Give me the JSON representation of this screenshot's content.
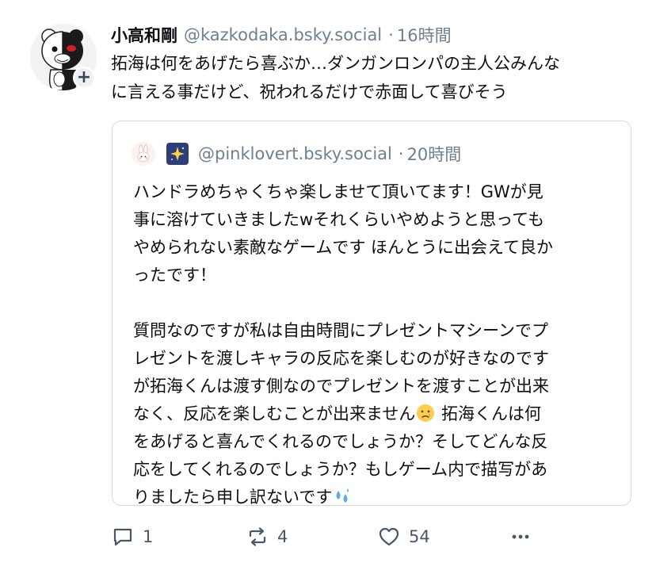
{
  "post": {
    "author": {
      "display_name": "小高和剛",
      "handle": "@kazkodaka.bsky.social",
      "separator": "·",
      "time": "16時間",
      "avatar_icon": "monokuma-avatar",
      "follow_badge": "+"
    },
    "text_lines": [
      "拓海は何をあげたら喜ぶか…ダンガンロンパの主人公みんな",
      "に言える事だけど、祝われるだけで赤面して喜びそう"
    ],
    "quote": {
      "avatar_icon": "bunny-avatar",
      "name_emoji_icon": "sparkle-star-icon",
      "handle": "@pinklovert.bsky.social",
      "separator": "·",
      "time": "20時間",
      "paragraph1_lines": [
        "ハンドラめちゃくちゃ楽しませて頂いてます！GWが見",
        "事に溶けていきましたwそれくらいやめようと思っても",
        "やめられない素敵なゲームです ほんとうに出会えて良か",
        "ったです！"
      ],
      "paragraph2_lines": [
        "質問なのですが私は自由時間にプレゼントマシーンでプ",
        "レゼントを渡しキャラの反応を楽しむのが好きなのです",
        "が拓海くんは渡す側なのでプレゼントを渡すことが出来",
        "なく、反応を楽しむことが出来ません",
        " 拓海くんは何",
        "をあげると喜んでくれるのでしょうか？そしてどんな反",
        "応をしてくれるのでしょうか？もしゲーム内で描写があ",
        "りましたら申し訳ないです"
      ],
      "emoji_sad": "sad-tear-face-icon",
      "emoji_sweat": "sweat-droplets-icon"
    },
    "actions": {
      "reply_count": "1",
      "repost_count": "4",
      "like_count": "54"
    },
    "colors": {
      "text": "#0b0f14",
      "muted": "#6f7f8f",
      "border": "#d4dbe2",
      "icon": "#4a5866"
    }
  }
}
